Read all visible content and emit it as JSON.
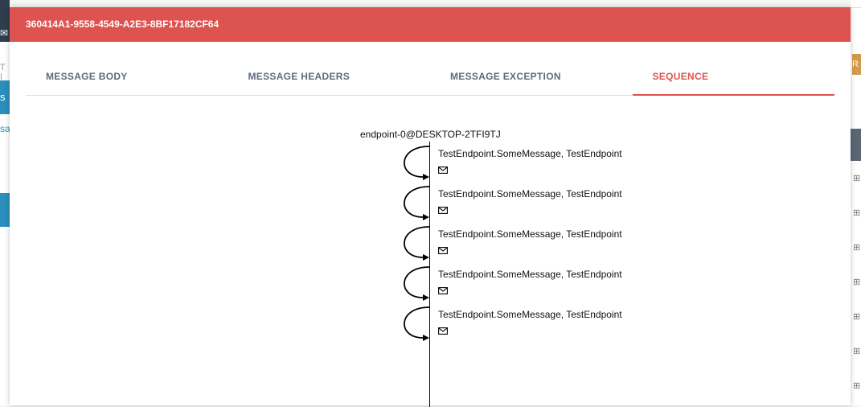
{
  "modal": {
    "title": "360414A1-9558-4549-A2E3-8BF17182CF64",
    "tabs": [
      {
        "label": "MESSAGE BODY",
        "active": false
      },
      {
        "label": "MESSAGE HEADERS",
        "active": false
      },
      {
        "label": "MESSAGE EXCEPTION",
        "active": false
      },
      {
        "label": "SEQUENCE",
        "active": true
      }
    ],
    "accent_color": "#dc534f"
  },
  "sequence": {
    "endpoint": "endpoint-0@DESKTOP-2TFI9TJ",
    "messages": [
      {
        "label": "TestEndpoint.SomeMessage, TestEndpoint",
        "icon": "envelope-icon"
      },
      {
        "label": "TestEndpoint.SomeMessage, TestEndpoint",
        "icon": "envelope-icon"
      },
      {
        "label": "TestEndpoint.SomeMessage, TestEndpoint",
        "icon": "envelope-icon"
      },
      {
        "label": "TestEndpoint.SomeMessage, TestEndpoint",
        "icon": "envelope-icon"
      },
      {
        "label": "TestEndpoint.SomeMessage, TestEndpoint",
        "icon": "envelope-icon"
      }
    ]
  },
  "background": {
    "left_button_text": "s",
    "left_link_text": "sag",
    "left_faded_text": "T I",
    "right_button_text": "R"
  }
}
